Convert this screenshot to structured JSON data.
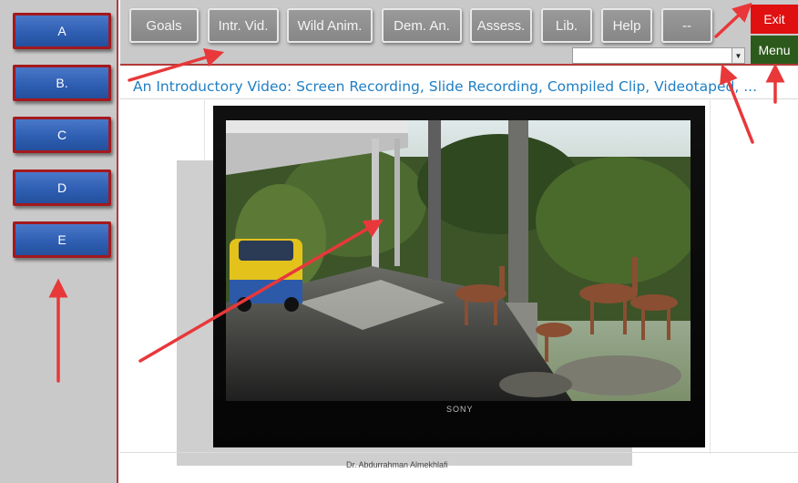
{
  "sidebar": {
    "buttons": [
      {
        "label": "A"
      },
      {
        "label": "B."
      },
      {
        "label": "C"
      },
      {
        "label": "D"
      },
      {
        "label": "E"
      }
    ]
  },
  "toolbar": {
    "buttons": [
      {
        "label": "Goals"
      },
      {
        "label": "Intr. Vid."
      },
      {
        "label": "Wild Anim."
      },
      {
        "label": "Dem. An."
      },
      {
        "label": "Assess."
      },
      {
        "label": "Lib."
      },
      {
        "label": "Help"
      },
      {
        "label": "--"
      }
    ],
    "exit_label": "Exit",
    "menu_label": "Menu",
    "combo_value": ""
  },
  "main": {
    "heading": "An Introductory Video: Screen Recording, Slide Recording, Compiled Clip, Videotaped, ...",
    "tv_brand": "SONY"
  },
  "footer": {
    "credit": "Dr. Abdurrahman Almekhlafi"
  },
  "colors": {
    "accent_blue": "#2f5fb3",
    "button_border_red": "#a3191d",
    "exit_red": "#e01010",
    "menu_green": "#2c5a1c",
    "heading_blue": "#1f7fc4",
    "annotation_arrow": "#e8383a"
  }
}
